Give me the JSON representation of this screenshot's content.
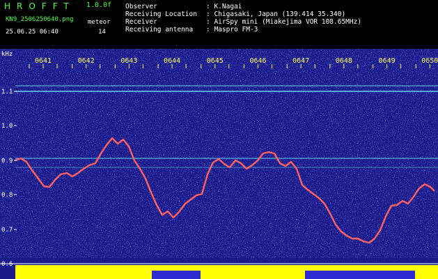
{
  "app": {
    "title": "HROFFT",
    "version": "1.0.0f",
    "filename": "KN9_2506250640.png",
    "meteor_label": "meteor",
    "datetime": "25.06.25 06:40",
    "meteor_count": "14"
  },
  "meta": [
    {
      "label": "Observer",
      "value": ": K.Nagai"
    },
    {
      "label": "Receiving Location",
      "value": ": Chigasaki, Japan (139.414 35.340)"
    },
    {
      "label": "Receiver",
      "value": ": AirSpy mini (Miakejima VOR 108.65MHz)"
    },
    {
      "label": "Receiving antenna",
      "value": ": Maspro FM-3"
    }
  ],
  "axis": {
    "y_unit": "kHz",
    "y_ticks": [
      "1.1",
      "1.0",
      "0.9",
      "0.8",
      "0.7",
      "0.6"
    ],
    "x_ticks": [
      "0641",
      "0642",
      "0643",
      "0644",
      "0645",
      "0646",
      "0647",
      "0648",
      "0649",
      "0650"
    ]
  },
  "colors": {
    "background": "#1a1a8c",
    "header_bg": "#000000",
    "title_green": "#4cff4c",
    "trace": "#ff6060",
    "cyan_line": "#6fe4ff",
    "noise_floor": "#ffff00"
  }
}
